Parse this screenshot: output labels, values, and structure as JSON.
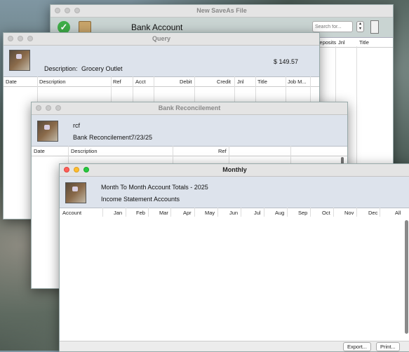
{
  "saveas": {
    "title": "New SaveAs File",
    "heading": "Bank Account",
    "search_placeholder": "Search for...",
    "columns": [
      "Deposits",
      "Jnl",
      "Title"
    ]
  },
  "query": {
    "title": "Query",
    "description_label": "Description:",
    "description_value": "Grocery Outlet",
    "amount": "$ 149.57",
    "columns": [
      "Date",
      "Description",
      "Ref",
      "Acct",
      "Debit",
      "Credit",
      "Jnl",
      "Title",
      "Job M..."
    ]
  },
  "reconcile": {
    "title": "Bank Reconcilement",
    "user": "rcf",
    "label": "Bank Reconcilement:",
    "date": "7/23/25",
    "columns": [
      "Date",
      "Description",
      "Ref"
    ]
  },
  "monthly": {
    "title": "Monthly",
    "heading": "Month To Month Account Totals - 2025",
    "subheading": "Income Statement Accounts",
    "columns": [
      "Account",
      "Jan",
      "Feb",
      "Mar",
      "Apr",
      "May",
      "Jun",
      "Jul",
      "Aug",
      "Sep",
      "Oct",
      "Nov",
      "Dec",
      "All"
    ],
    "export_label": "Export...",
    "print_label": "Print..."
  }
}
